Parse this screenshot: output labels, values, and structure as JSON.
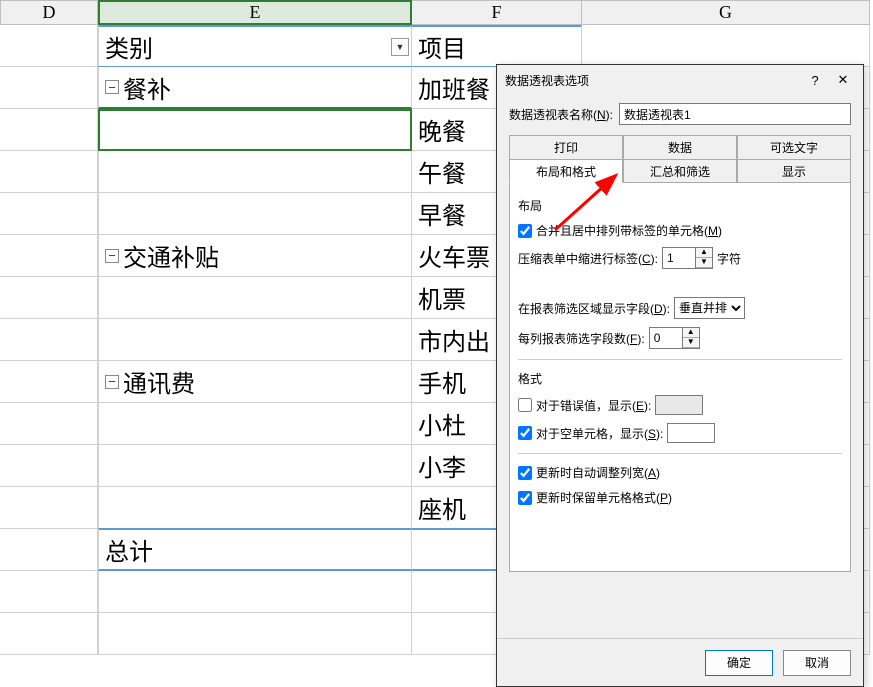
{
  "columns": {
    "d": "D",
    "e": "E",
    "f": "F",
    "g": "G"
  },
  "pivot_headers": {
    "category": "类别",
    "item": "项目"
  },
  "rows": [
    {
      "e": "餐补",
      "f": "加班餐",
      "collapse": true
    },
    {
      "e": "",
      "f": "晚餐"
    },
    {
      "e": "",
      "f": "午餐"
    },
    {
      "e": "",
      "f": "早餐"
    },
    {
      "e": "交通补贴",
      "f": "火车票",
      "collapse": true
    },
    {
      "e": "",
      "f": "机票"
    },
    {
      "e": "",
      "f": "市内出"
    },
    {
      "e": "通讯费",
      "f": "手机",
      "collapse": true
    },
    {
      "e": "",
      "f": "小杜"
    },
    {
      "e": "",
      "f": "小李"
    },
    {
      "e": "",
      "f": "座机"
    }
  ],
  "total_label": "总计",
  "collapse_glyph": "−",
  "filter_glyph": "▼",
  "dialog": {
    "title": "数据透视表选项",
    "help": "?",
    "close": "✕",
    "name_label_pre": "数据透视表名称(",
    "name_label_ul": "N",
    "name_label_post": "):",
    "name_value": "数据透视表1",
    "tabs": {
      "print": "打印",
      "data": "数据",
      "alttext": "可选文字",
      "layout": "布局和格式",
      "totals": "汇总和筛选",
      "display": "显示"
    },
    "layout_section": "布局",
    "opt_merge_pre": "合并且居中排列带标签的单元格(",
    "opt_merge_ul": "M",
    "opt_merge_post": ")",
    "indent_label_pre": "压缩表单中缩进行标签(",
    "indent_label_ul": "C",
    "indent_label_post": "):",
    "indent_value": "1",
    "indent_unit": "字符",
    "filter_area_pre": "在报表筛选区域显示字段(",
    "filter_area_ul": "D",
    "filter_area_post": "):",
    "filter_area_value": "垂直并排",
    "filter_cols_pre": "每列报表筛选字段数(",
    "filter_cols_ul": "F",
    "filter_cols_post": "):",
    "filter_cols_value": "0",
    "format_section": "格式",
    "err_show_pre": "对于错误值，显示(",
    "err_show_ul": "E",
    "err_show_post": "):",
    "empty_show_pre": "对于空单元格，显示(",
    "empty_show_ul": "S",
    "empty_show_post": "):",
    "autofit_pre": "更新时自动调整列宽(",
    "autofit_ul": "A",
    "autofit_post": ")",
    "preserve_pre": "更新时保留单元格格式(",
    "preserve_ul": "P",
    "preserve_post": ")",
    "ok": "确定",
    "cancel": "取消"
  }
}
